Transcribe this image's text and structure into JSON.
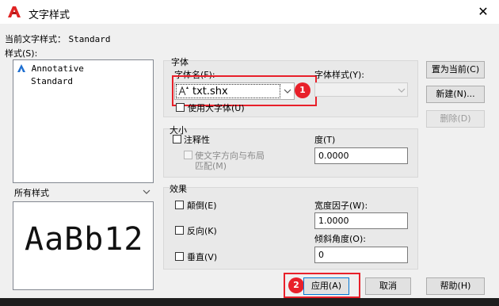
{
  "window": {
    "title": "文字样式",
    "close_glyph": "✕"
  },
  "current_style": {
    "label": "当前文字样式：",
    "value": "Standard"
  },
  "styles": {
    "label": "样式(S):",
    "items": [
      "Annotative",
      "Standard"
    ],
    "filter_value": "所有样式"
  },
  "font": {
    "group_label": "字体",
    "font_name_label": "字体名(F):",
    "font_name_value": "txt.shx",
    "font_style_label": "字体样式(Y):",
    "use_big_font_label": "使用大字体(U)"
  },
  "size": {
    "group_label": "大小",
    "annotative_label": "注释性",
    "match_orientation_label_1": "使文字方向与布局",
    "match_orientation_label_2": "匹配(M)",
    "height_label": "度(T)",
    "height_value": "0.0000"
  },
  "effects": {
    "group_label": "效果",
    "upside_down_label": "颠倒(E)",
    "backwards_label": "反向(K)",
    "vertical_label": "垂直(V)",
    "width_factor_label": "宽度因子(W):",
    "width_factor_value": "1.0000",
    "oblique_label": "倾斜角度(O):",
    "oblique_value": "0"
  },
  "preview_text": "AaBb12",
  "buttons": {
    "set_current": "置为当前(C)",
    "new": "新建(N)...",
    "delete": "删除(D)",
    "apply": "应用(A)",
    "cancel": "取消",
    "help": "帮助(H)"
  },
  "annotations": {
    "badge_1": "1",
    "badge_2": "2"
  },
  "colors": {
    "highlight_red": "#e8202a",
    "annotative_icon": "#1f6fd0"
  }
}
